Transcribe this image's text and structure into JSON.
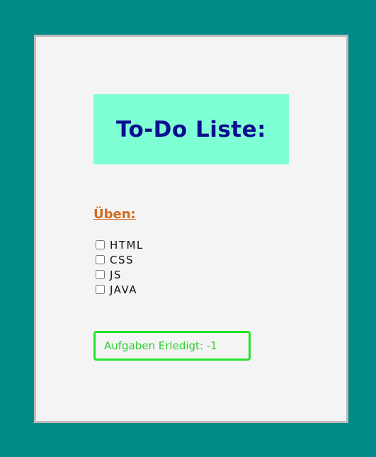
{
  "page": {
    "title": "To-Do Liste:",
    "section_heading": "Üben:",
    "tasks": [
      {
        "label": "HTML",
        "checked": false
      },
      {
        "label": "CSS",
        "checked": false
      },
      {
        "label": "JS",
        "checked": false
      },
      {
        "label": "JAVA",
        "checked": false
      }
    ],
    "status_label": "Aufgaben Erledigt: -1"
  },
  "colors": {
    "page_background": "#028a88",
    "card_background": "#f4f4f4",
    "title_background": "#7fffd4",
    "title_text": "#0d0d8f",
    "heading_text": "#d2691e",
    "status_border": "#22e32a",
    "status_text": "#2ecf2e"
  }
}
